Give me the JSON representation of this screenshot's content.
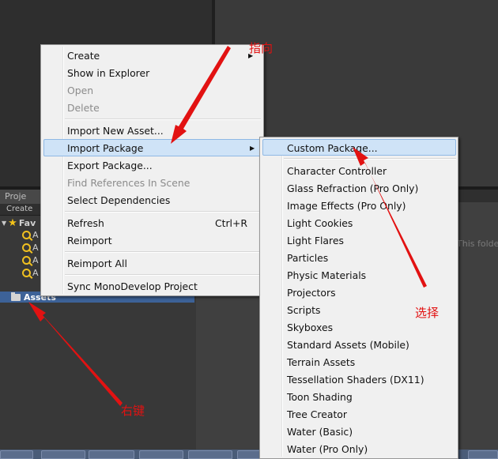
{
  "project_panel": {
    "tab_label": "Proje",
    "create_label": "Create",
    "favorites_label": "Fav",
    "favorite_items": [
      "A",
      "A",
      "A",
      "A"
    ],
    "assets_label": "Assets",
    "empty_folder_text": "This folde"
  },
  "context_menu": {
    "items": [
      {
        "label": "Create",
        "has_submenu": true
      },
      {
        "label": "Show in Explorer"
      },
      {
        "label": "Open",
        "disabled": true
      },
      {
        "label": "Delete",
        "disabled": true
      },
      {
        "label": "Import New Asset..."
      },
      {
        "label": "Import Package",
        "has_submenu": true,
        "highlighted": true
      },
      {
        "label": "Export Package..."
      },
      {
        "label": "Find References In Scene",
        "disabled": true
      },
      {
        "label": "Select Dependencies"
      },
      {
        "label": "Refresh",
        "shortcut": "Ctrl+R"
      },
      {
        "label": "Reimport"
      },
      {
        "label": "Reimport All"
      },
      {
        "label": "Sync MonoDevelop Project"
      }
    ]
  },
  "import_package_submenu": {
    "items": [
      {
        "label": "Custom Package...",
        "highlighted": true
      },
      {
        "label": "Character Controller"
      },
      {
        "label": "Glass Refraction (Pro Only)"
      },
      {
        "label": "Image Effects (Pro Only)"
      },
      {
        "label": "Light Cookies"
      },
      {
        "label": "Light Flares"
      },
      {
        "label": "Particles"
      },
      {
        "label": "Physic Materials"
      },
      {
        "label": "Projectors"
      },
      {
        "label": "Scripts"
      },
      {
        "label": "Skyboxes"
      },
      {
        "label": "Standard Assets (Mobile)"
      },
      {
        "label": "Terrain Assets"
      },
      {
        "label": "Tessellation Shaders (DX11)"
      },
      {
        "label": "Toon Shading"
      },
      {
        "label": "Tree Creator"
      },
      {
        "label": "Water (Basic)"
      },
      {
        "label": "Water (Pro Only)"
      }
    ]
  },
  "annotations": {
    "point_to": "指向",
    "select": "选择",
    "right_click": "右键"
  },
  "colors": {
    "annotation_red": "#e21212",
    "menu_background": "#f0f0f0",
    "highlight_fill": "#cfe3f7",
    "assets_selection": "#3d6298"
  }
}
